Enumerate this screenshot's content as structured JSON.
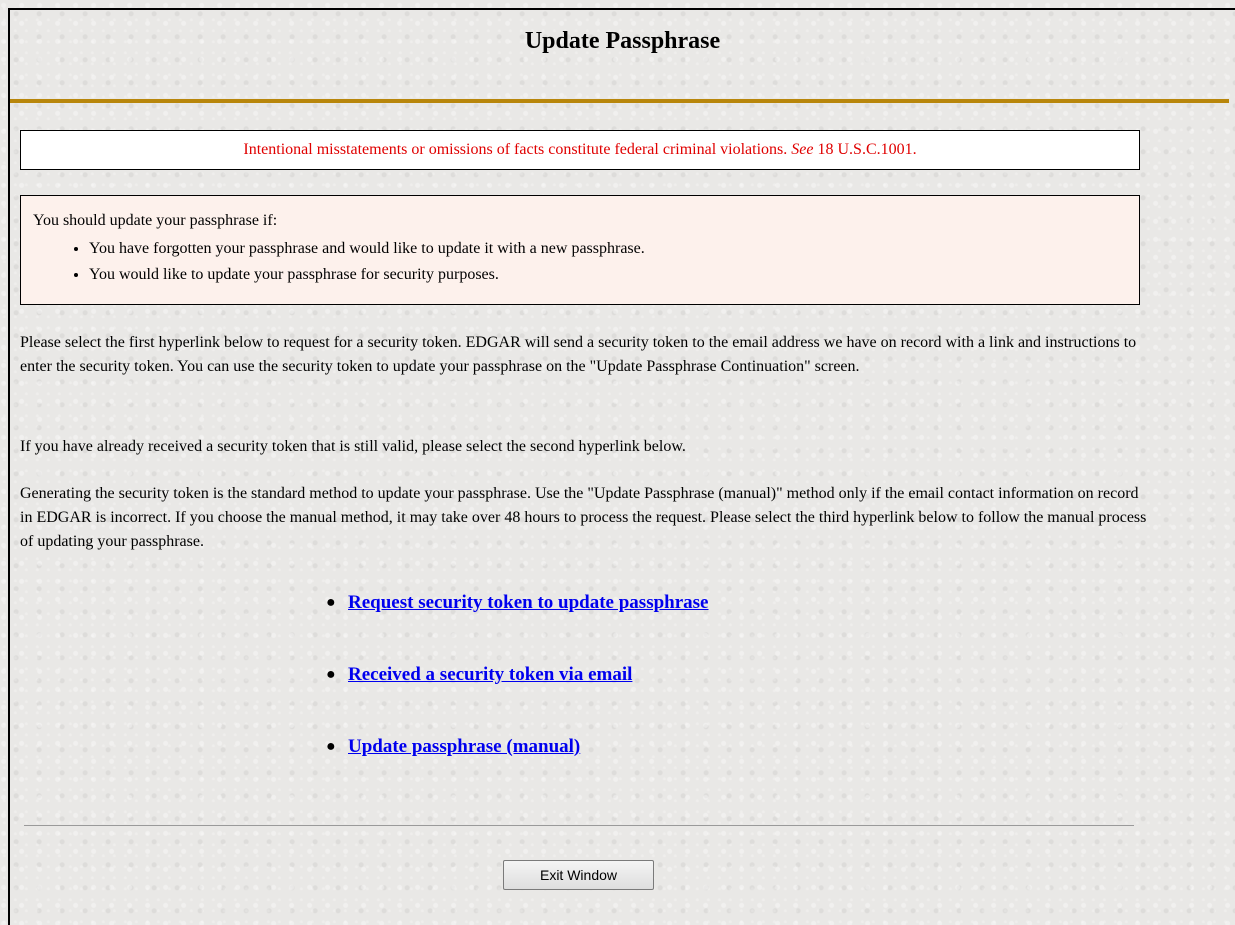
{
  "page": {
    "title": "Update Passphrase"
  },
  "warning": {
    "text_before": "Intentional misstatements or omissions of facts constitute federal criminal violations. ",
    "see": "See",
    "text_after": " 18 U.S.C.1001."
  },
  "info": {
    "intro": "You should update your passphrase if:",
    "items": [
      "You have forgotten your passphrase and would like to update it with a new passphrase.",
      "You would like to update your passphrase for security purposes."
    ]
  },
  "paragraphs": [
    "Please select the first hyperlink below to request for a security token. EDGAR will send a security token to the email address we have on record with a link and instructions to enter the security token. You can use the security token to update your passphrase on the \"Update Passphrase Continuation\" screen.",
    "If you have already received a security token that is still valid, please select the second hyperlink below.",
    "Generating the security token is the standard method to update your passphrase. Use the \"Update Passphrase (manual)\" method only if the email contact information on record in EDGAR is incorrect. If you choose the manual method, it may take over 48 hours to process the request. Please select the third hyperlink below to follow the manual process of updating your passphrase."
  ],
  "links": [
    "Request security token to update passphrase",
    "Received a security token via email",
    "Update passphrase (manual)"
  ],
  "footer": {
    "exit_label": "Exit Window"
  },
  "colors": {
    "title_rule": "#b8860b",
    "warning_text": "#e00000",
    "info_background": "#fdf1ec",
    "link": "#0000ee"
  }
}
